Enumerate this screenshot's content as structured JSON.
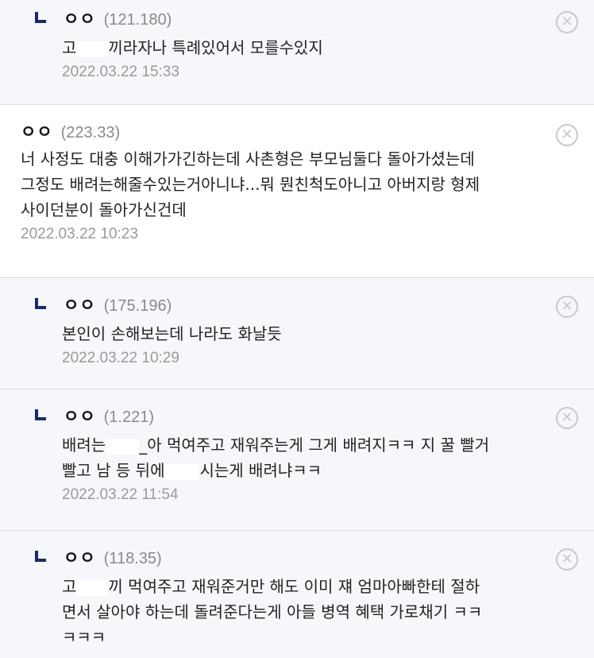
{
  "comments": [
    {
      "nick": "ㅇㅇ",
      "ip": "(121.180)",
      "lines": [
        "고",
        "끼라자나 특례있어서 모를수있지"
      ],
      "date": "2022.03.22 15:33"
    },
    {
      "nick": "ㅇㅇ",
      "ip": "(223.33)",
      "lines": [
        "너 사정도 대충 이해가가긴하는데 사촌형은 부모님둘다 돌아가셨는데",
        "그정도 배려는해줄수있는거아니냐...뭐 뭔친척도아니고 아버지랑 형제",
        "사이던분이 돌아가신건데"
      ],
      "date": "2022.03.22 10:23"
    },
    {
      "nick": "ㅇㅇ",
      "ip": "(175.196)",
      "lines": [
        "본인이 손해보는데 나라도 화날듯"
      ],
      "date": "2022.03.22 10:29"
    },
    {
      "nick": "ㅇㅇ",
      "ip": "(1.221)",
      "lines": [
        "배려는",
        "_아 먹여주고 재워주는게 그게 배려지ㅋㅋ 지 꿀 빨거",
        "빨고 남 등 뒤에",
        "시는게 배려냐ㅋㅋ"
      ],
      "date": "2022.03.22 11:54"
    },
    {
      "nick": "ㅇㅇ",
      "ip": "(118.35)",
      "lines": [
        "고",
        "끼 먹여주고 재워준거만 해도 이미 쟤 엄마아빠한테 절하",
        "면서 살아야 하는데 돌려준다는게 아들 병역 혜택 가로채기 ㅋㅋ",
        "ㅋㅋㅋ"
      ],
      "date": ""
    }
  ],
  "icons": {
    "reply": "reply-arrow-icon",
    "delete": "delete-x-icon"
  }
}
